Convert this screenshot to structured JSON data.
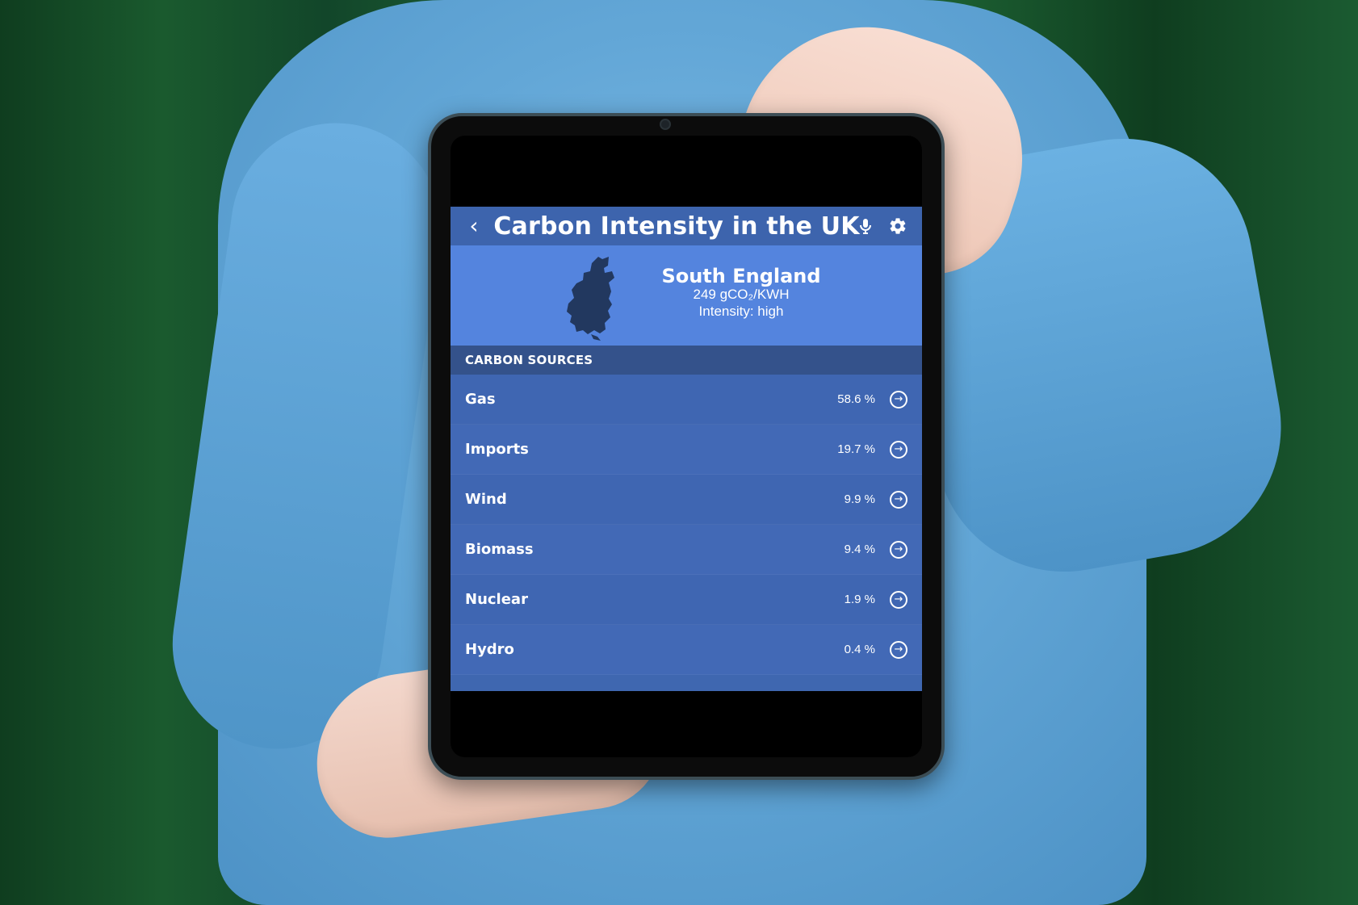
{
  "app": {
    "title": "Carbon Intensity in the UK"
  },
  "region": {
    "name": "South England",
    "intensity_value": "249 gCO₂/KWH",
    "intensity_status": "Intensity: high"
  },
  "section": {
    "title": "CARBON SOURCES"
  },
  "sources": [
    {
      "name": "Gas",
      "percent": "58.6 %"
    },
    {
      "name": "Imports",
      "percent": "19.7 %"
    },
    {
      "name": "Wind",
      "percent": "9.9 %"
    },
    {
      "name": "Biomass",
      "percent": "9.4 %"
    },
    {
      "name": "Nuclear",
      "percent": "1.9 %"
    },
    {
      "name": "Hydro",
      "percent": "0.4 %"
    }
  ],
  "colors": {
    "header": "#3d64ad",
    "region_panel": "#5484de",
    "section_header": "#34528b",
    "row": "#3f66b2"
  },
  "icons": {
    "back": "chevron-left-icon",
    "mic": "mic-icon",
    "settings": "gear-icon",
    "row_action": "arrow-circle-icon"
  }
}
